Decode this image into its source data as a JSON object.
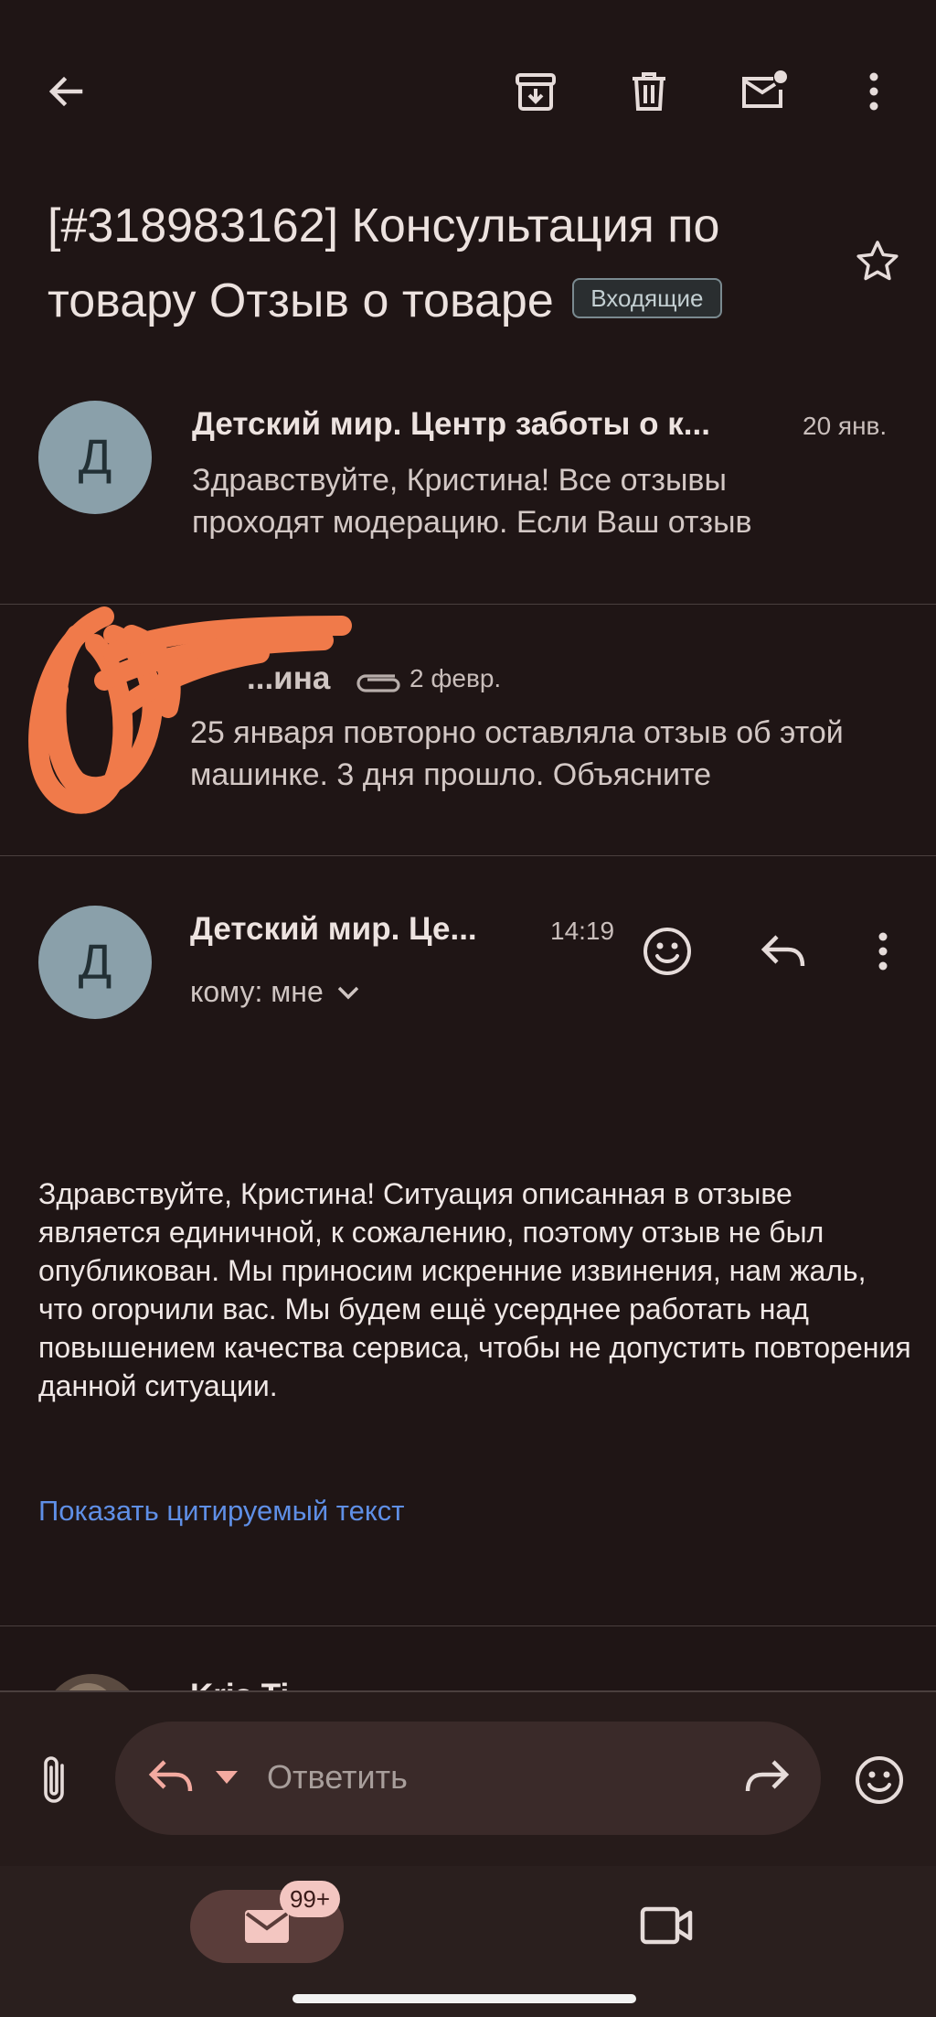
{
  "toolbar": {
    "back": "back-arrow-icon",
    "archive": "archive-icon",
    "delete": "trash-icon",
    "mark_unread": "mark-unread-icon",
    "more": "more-vertical-icon"
  },
  "thread": {
    "subject": "[#318983162] Консультация по товару Отзыв о товаре",
    "label": "Входящие"
  },
  "messages": [
    {
      "avatar_letter": "Д",
      "sender": "Детский мир. Центр заботы о к...",
      "date": "20 янв.",
      "snippet": "Здравствуйте, Кристина! Все отзывы проходят модерацию. Если Ваш отзыв"
    },
    {
      "sender": "...ина",
      "date": "2 февр.",
      "snippet": "25 января повторно оставляла отзыв об этой машинке. 3 дня прошло. Объясните"
    },
    {
      "avatar_letter": "Д",
      "sender": "Детский мир. Це...",
      "time": "14:19",
      "to": "кому: мне",
      "body": "Здравствуйте, Кристина! Ситуация описанная в отзыве является единичной, к сожалению, поэтому отзыв не был опубликован. Мы приносим искренние извинения, нам жаль, что огорчили вас. Мы будем ещё усерднее работать над повышением качества сервиса, чтобы не допустить повторения данной ситуации.",
      "show_quoted": "Показать цитируемый текст"
    },
    {
      "sender": "Kris Ti..."
    }
  ],
  "compose": {
    "reply_placeholder": "Ответить"
  },
  "bottom_nav": {
    "mail_badge": "99+"
  },
  "colors": {
    "background": "#1f1515",
    "link": "#5f8fe6",
    "scribble": "#f07a4a",
    "badge": "#f3c6c1"
  }
}
